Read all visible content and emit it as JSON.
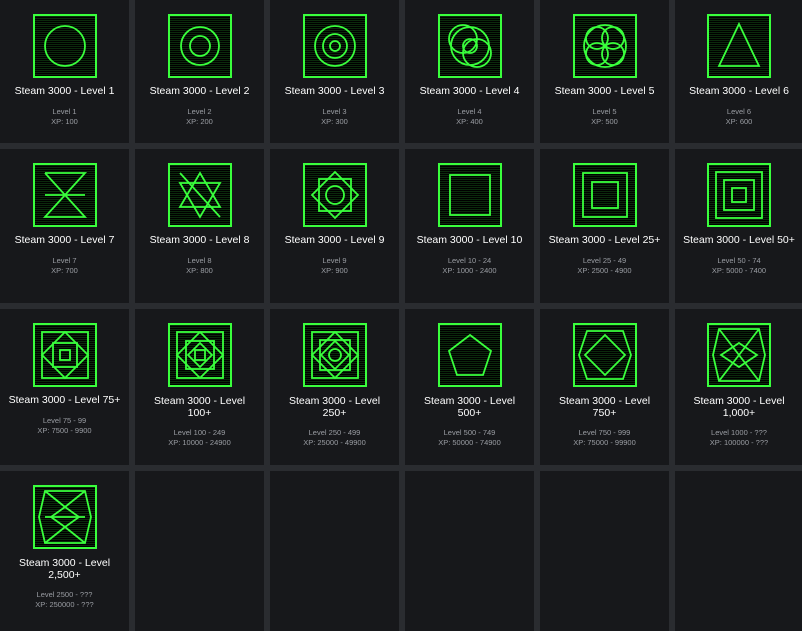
{
  "badges": [
    {
      "title": "Steam 3000 - Level 1",
      "level": "Level 1",
      "xp": "XP: 100",
      "icon": "circle-badge-icon"
    },
    {
      "title": "Steam 3000 - Level 2",
      "level": "Level 2",
      "xp": "XP: 200",
      "icon": "double-circle-badge-icon"
    },
    {
      "title": "Steam 3000 - Level 3",
      "level": "Level 3",
      "xp": "XP: 300",
      "icon": "triple-circle-badge-icon"
    },
    {
      "title": "Steam 3000 - Level 4",
      "level": "Level 4",
      "xp": "XP: 400",
      "icon": "overlapping-circles-badge-icon"
    },
    {
      "title": "Steam 3000 - Level 5",
      "level": "Level 5",
      "xp": "XP: 500",
      "icon": "four-circles-badge-icon"
    },
    {
      "title": "Steam 3000 - Level 6",
      "level": "Level 6",
      "xp": "XP: 600",
      "icon": "triangle-badge-icon"
    },
    {
      "title": "Steam 3000 - Level 7",
      "level": "Level 7",
      "xp": "XP: 700",
      "icon": "hourglass-badge-icon"
    },
    {
      "title": "Steam 3000 - Level 8",
      "level": "Level 8",
      "xp": "XP: 800",
      "icon": "star-of-david-badge-icon"
    },
    {
      "title": "Steam 3000 - Level 9",
      "level": "Level 9",
      "xp": "XP: 900",
      "icon": "eight-point-star-badge-icon"
    },
    {
      "title": "Steam 3000 - Level 10",
      "level": "Level 10 - 24",
      "xp": "XP: 1000 - 2400",
      "icon": "square-badge-icon"
    },
    {
      "title": "Steam 3000 - Level 25+",
      "level": "Level 25 - 49",
      "xp": "XP: 2500 - 4900",
      "icon": "double-square-badge-icon"
    },
    {
      "title": "Steam 3000 - Level 50+",
      "level": "Level 50 - 74",
      "xp": "XP: 5000 - 7400",
      "icon": "triple-square-badge-icon"
    },
    {
      "title": "Steam 3000 - Level 75+",
      "level": "Level 75 - 99",
      "xp": "XP: 7500 - 9900",
      "icon": "diamond-squares-badge-icon"
    },
    {
      "title": "Steam 3000 - Level 100+",
      "level": "Level 100 - 249",
      "xp": "XP: 10000 - 24900",
      "icon": "diamond-squares-2-badge-icon"
    },
    {
      "title": "Steam 3000 - Level 250+",
      "level": "Level 250 - 499",
      "xp": "XP: 25000 - 49900",
      "icon": "diamond-circle-badge-icon"
    },
    {
      "title": "Steam 3000 - Level 500+",
      "level": "Level 500 - 749",
      "xp": "XP: 50000 - 74900",
      "icon": "pentagon-badge-icon"
    },
    {
      "title": "Steam 3000 - Level 750+",
      "level": "Level 750 - 999",
      "xp": "XP: 75000 - 99900",
      "icon": "hexagon-badge-icon"
    },
    {
      "title": "Steam 3000 - Level 1,000+",
      "level": "Level 1000 - ???",
      "xp": "XP: 100000 - ???",
      "icon": "hexagon-cross-badge-icon"
    },
    {
      "title": "Steam 3000 - Level 2,500+",
      "level": "Level 2500 - ???",
      "xp": "XP: 250000 - ???",
      "icon": "hexagon-diamond-badge-icon"
    }
  ],
  "colors": {
    "accent": "#39ff3c",
    "background": "#17181b",
    "gap": "#2a2c30"
  }
}
